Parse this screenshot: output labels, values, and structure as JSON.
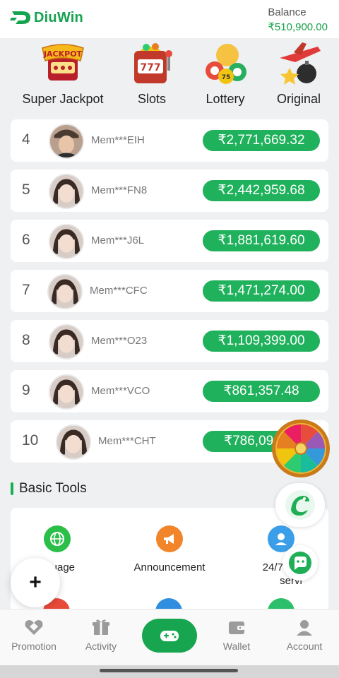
{
  "app": {
    "brand": "DiuWin",
    "colors": {
      "primary": "#17a64f",
      "accent_red": "#f05a5a",
      "tab_blue": "#6a74b3",
      "tab_orange": "#e96a3a"
    }
  },
  "header": {
    "balance_label": "Balance",
    "balance_value": "₹510,900.00"
  },
  "tabs": [
    {
      "label": "Super Jackpot",
      "icon": "jackpot-icon",
      "badge_text": "JACKPOT"
    },
    {
      "label": "Slots",
      "icon": "slot-machine-icon",
      "badge_text": "777"
    },
    {
      "label": "Lottery",
      "icon": "lottery-balls-icon",
      "badge_text": "75"
    },
    {
      "label": "Original",
      "icon": "airplane-bomb-icon"
    }
  ],
  "ranking": [
    {
      "rank": "4",
      "member": "Mem***EIH",
      "amount": "₹2,771,669.32"
    },
    {
      "rank": "5",
      "member": "Mem***FN8",
      "amount": "₹2,442,959.68"
    },
    {
      "rank": "6",
      "member": "Mem***J6L",
      "amount": "₹1,881,619.60"
    },
    {
      "rank": "7",
      "member": "Mem***CFC",
      "amount": "₹1,471,274.00"
    },
    {
      "rank": "8",
      "member": "Mem***O23",
      "amount": "₹1,109,399.00"
    },
    {
      "rank": "9",
      "member": "Mem***VCO",
      "amount": "₹861,357.48"
    },
    {
      "rank": "10",
      "member": "Mem***CHT",
      "amount": "₹786,09"
    }
  ],
  "basic_tools": {
    "title": "Basic Tools",
    "items": [
      {
        "label": "nguage",
        "icon": "globe-icon",
        "color": "#2bbf4a"
      },
      {
        "label": "Announcement",
        "icon": "megaphone-icon",
        "color": "#f2852a"
      },
      {
        "label": "24/7 Cu",
        "label2": "servi",
        "icon": "support-agent-icon",
        "color": "#3b9ee8"
      }
    ]
  },
  "floating": {
    "plus_label": "+"
  },
  "bottom_nav": [
    {
      "label": "Promotion",
      "icon": "diamond-heart-icon"
    },
    {
      "label": "Activity",
      "icon": "gift-icon"
    },
    {
      "label": "",
      "icon": "gamepad-icon"
    },
    {
      "label": "Wallet",
      "icon": "wallet-icon"
    },
    {
      "label": "Account",
      "icon": "account-icon"
    }
  ]
}
